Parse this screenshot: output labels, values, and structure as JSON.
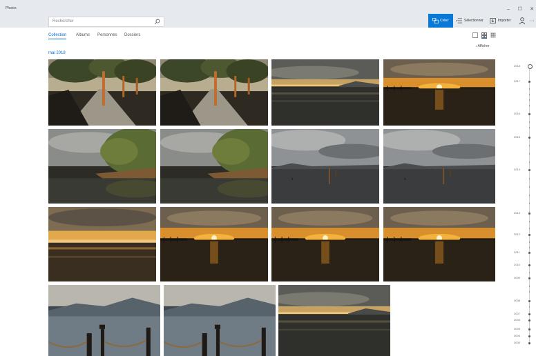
{
  "app": {
    "title": "Photos"
  },
  "window_controls": {
    "minimize": "–",
    "maximize": "☐",
    "close": "✕"
  },
  "search": {
    "placeholder": "Rechercher"
  },
  "toolbar": {
    "create_label": "Créer",
    "select_label": "Sélectionner",
    "import_label": "Importer",
    "more": "···"
  },
  "nav": {
    "tabs": [
      "Collection",
      "Albums",
      "Personnes",
      "Dossiers"
    ],
    "active": "Collection"
  },
  "show_label": "Afficher",
  "group": {
    "month": "mai 2018"
  },
  "photos": [
    {
      "scene": "tree-shore-path"
    },
    {
      "scene": "tree-shore-path"
    },
    {
      "scene": "calm-lake-sunset"
    },
    {
      "scene": "jetty-sun-glow"
    },
    {
      "scene": "tree-shore-reflection"
    },
    {
      "scene": "tree-shore-reflection"
    },
    {
      "scene": "lake-posts-grey"
    },
    {
      "scene": "lake-posts-grey"
    },
    {
      "scene": "golden-horizon"
    },
    {
      "scene": "jetty-sun-glow"
    },
    {
      "scene": "jetty-sun-glow"
    },
    {
      "scene": "jetty-sun-glow"
    },
    {
      "scene": "mountain-pier-rope"
    },
    {
      "scene": "mountain-pier-rope"
    },
    {
      "scene": "calm-lake-sunset"
    }
  ],
  "timeline": {
    "years": [
      "2018",
      "2017",
      "2016",
      "2015",
      "2014",
      "2013",
      "2012",
      "2011",
      "2010",
      "2009",
      "2008",
      "2007",
      "2006",
      "2005",
      "2004",
      "2003"
    ]
  },
  "colors": {
    "accent": "#0a78d7",
    "titlebar": "#e6e9ee"
  }
}
